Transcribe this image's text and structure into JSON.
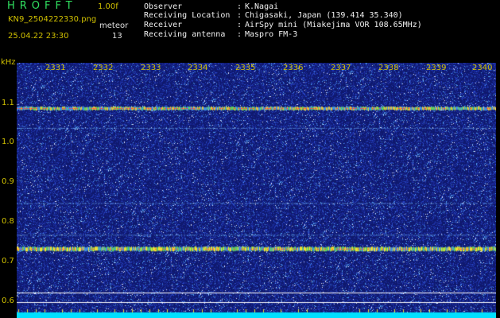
{
  "app": {
    "logo": "HROFFT",
    "version": "1.00f",
    "filename": "KN9_2504222330.png",
    "meteor_label": "meteor",
    "datetime": "25.04.22 23:30",
    "meteor_count": "13"
  },
  "info": [
    {
      "key": "Observer",
      "value": "K.Nagai"
    },
    {
      "key": "Receiving Location",
      "value": "Chigasaki, Japan (139.414 35.340)"
    },
    {
      "key": "Receiver",
      "value": "AirSpy mini (Miakejima VOR 108.65MHz)"
    },
    {
      "key": "Receiving antenna",
      "value": "Maspro FM-3"
    }
  ],
  "axis": {
    "y_unit": "kHz",
    "y_ticks": [
      "1.1",
      "1.0",
      "0.9",
      "0.8",
      "0.7",
      "0.6"
    ],
    "x_ticks": [
      "2331",
      "2332",
      "2333",
      "2334",
      "2335",
      "2336",
      "2337",
      "2338",
      "2339",
      "2340"
    ]
  },
  "colors": {
    "background": "#000000",
    "waterfall": "#101a7a",
    "text_yellow": "#d0c000",
    "logo_green": "#30e060",
    "carrier_band": "#f0e030"
  },
  "signals_khz": [
    1.09,
    1.04,
    0.85,
    0.77,
    0.735
  ]
}
